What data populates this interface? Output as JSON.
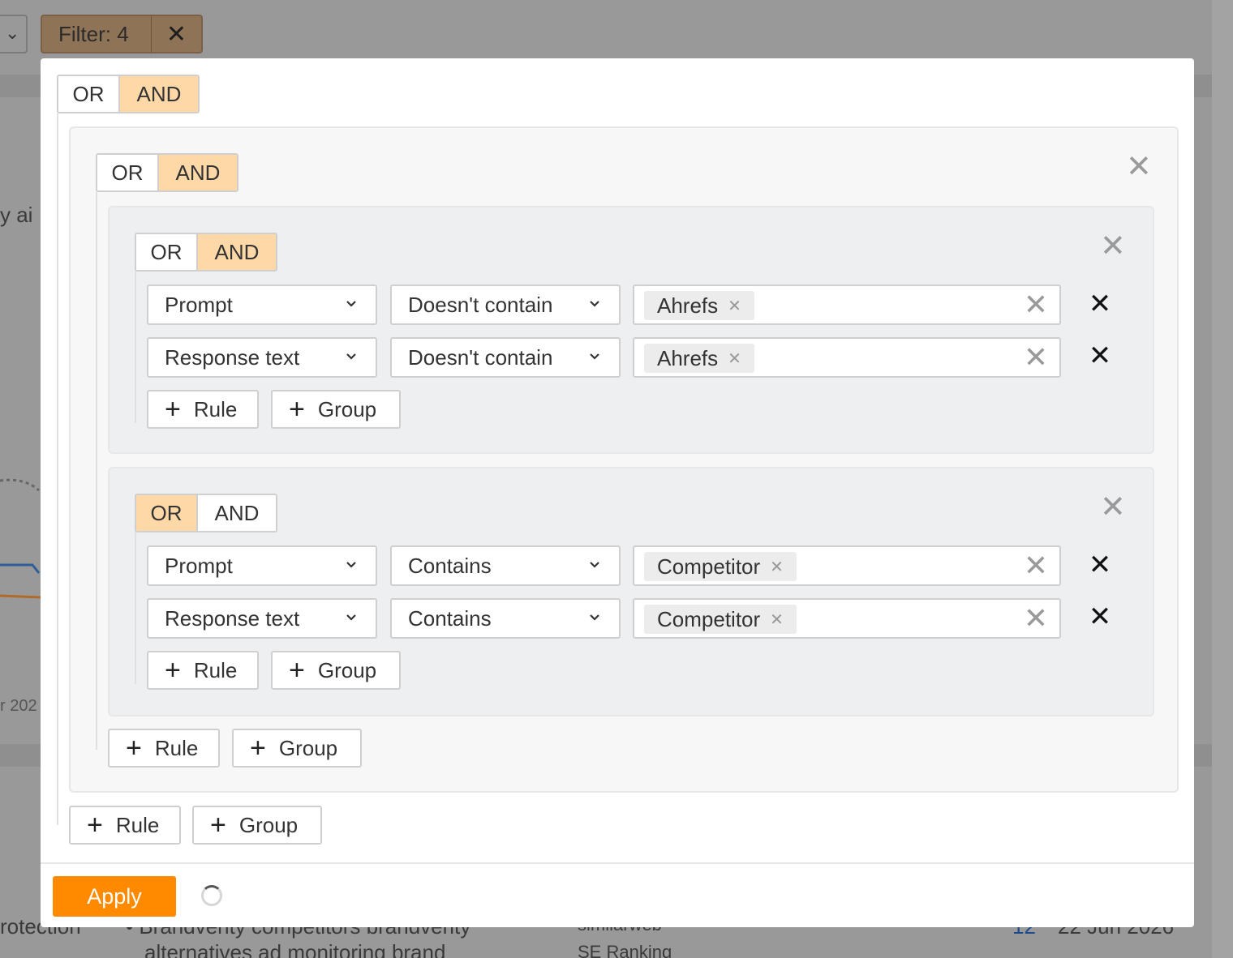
{
  "background": {
    "filter_label": "Filter: 4",
    "filter_clear": "✕",
    "fragment_ai": "y ai",
    "fragment_date": "r 202",
    "fragment_protection": "rotection",
    "fragment_keywords_1": "• Brandverity competitors brandverity",
    "fragment_keywords_2": "alternatives ad monitoring brand",
    "fragment_src_1": "similarweb",
    "fragment_src_2": "SE Ranking",
    "fragment_num": "12",
    "fragment_date_full": "22 Jun 2026"
  },
  "root": {
    "or_label": "OR",
    "and_label": "AND",
    "active": "AND",
    "add_rule": "Rule",
    "add_group": "Group"
  },
  "level1": {
    "or_label": "OR",
    "and_label": "AND",
    "active": "AND",
    "add_rule": "Rule",
    "add_group": "Group"
  },
  "groupA": {
    "or_label": "OR",
    "and_label": "AND",
    "active": "AND",
    "rules": [
      {
        "field": "Prompt",
        "operator": "Doesn't contain",
        "value": "Ahrefs"
      },
      {
        "field": "Response text",
        "operator": "Doesn't contain",
        "value": "Ahrefs"
      }
    ],
    "add_rule": "Rule",
    "add_group": "Group"
  },
  "groupB": {
    "or_label": "OR",
    "and_label": "AND",
    "active": "OR",
    "rules": [
      {
        "field": "Prompt",
        "operator": "Contains",
        "value": "Competitor"
      },
      {
        "field": "Response text",
        "operator": "Contains",
        "value": "Competitor"
      }
    ],
    "add_rule": "Rule",
    "add_group": "Group"
  },
  "footer": {
    "apply_label": "Apply"
  },
  "colors": {
    "accent": "#ff8a00",
    "toggle_active": "#ffd8a8"
  }
}
